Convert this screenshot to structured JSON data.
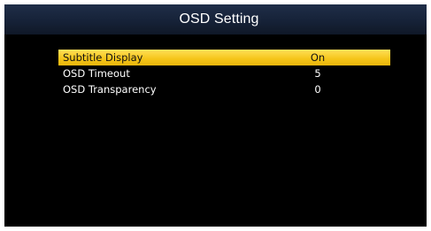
{
  "title": "OSD Setting",
  "menu": {
    "items": [
      {
        "label": "Subtitle Display",
        "value": "On",
        "selected": true
      },
      {
        "label": "OSD Timeout",
        "value": "5",
        "selected": false
      },
      {
        "label": "OSD Transparency",
        "value": "0",
        "selected": false
      }
    ]
  },
  "colors": {
    "highlight": "#f5c418",
    "title_bar": "#1a263c",
    "background": "#000000"
  }
}
